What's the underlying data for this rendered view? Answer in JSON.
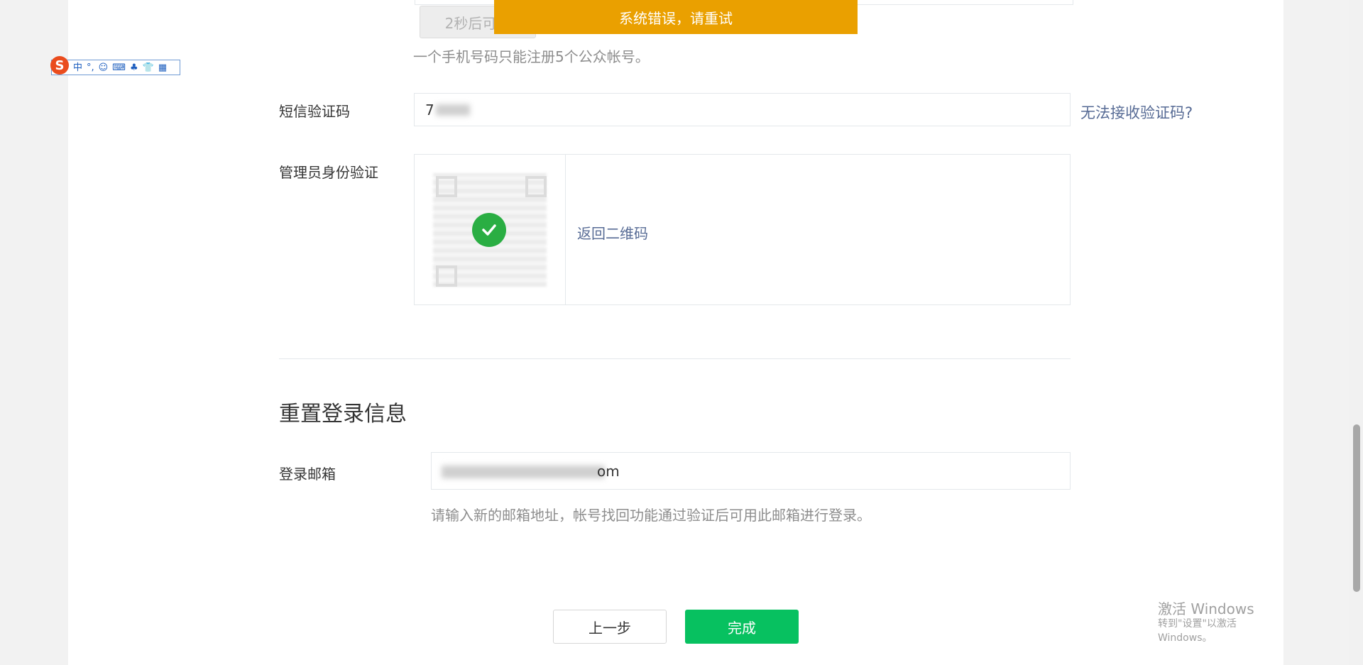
{
  "toast": {
    "message": "系统错误，请重试"
  },
  "phone_section": {
    "resend_button_label": "2秒后可重",
    "hint": "一个手机号码只能注册5个公众帐号。"
  },
  "sms": {
    "label": "短信验证码",
    "value": "7",
    "cannot_receive_link": "无法接收验证码?"
  },
  "admin_verify": {
    "label": "管理员身份验证",
    "back_link": "返回二维码"
  },
  "reset": {
    "section_title": "重置登录信息",
    "email_label": "登录邮箱",
    "email_value_visible": "om",
    "email_hint": "请输入新的邮箱地址，帐号找回功能通过验证后可用此邮箱进行登录。"
  },
  "actions": {
    "prev_label": "上一步",
    "done_label": "完成"
  },
  "ime": {
    "logo": "S",
    "items": [
      "中",
      "°,",
      "☺",
      "⌨",
      "♣",
      "👕",
      "▦"
    ]
  },
  "windows_watermark": {
    "title": "激活 Windows",
    "subtitle": "转到\"设置\"以激活 Windows。"
  },
  "colors": {
    "toast_bg": "#eaa000",
    "primary_green": "#07c160",
    "link_blue": "#576b95",
    "check_green": "#2aae43"
  }
}
